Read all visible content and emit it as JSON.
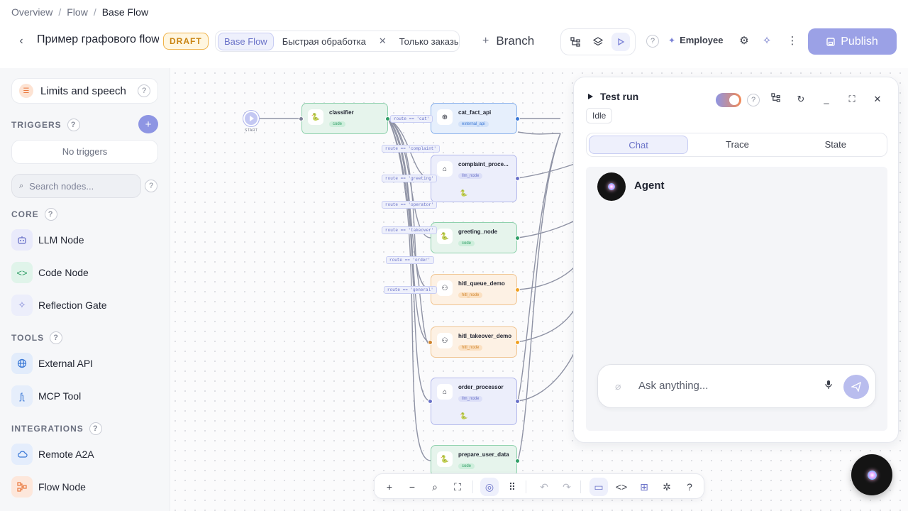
{
  "breadcrumb": {
    "items": [
      "Overview",
      "Flow"
    ],
    "current": "Base Flow"
  },
  "header": {
    "title": "Пример графового flow",
    "draft_badge": "DRAFT",
    "tabs": [
      {
        "label": "Base Flow",
        "active": true
      },
      {
        "label": "Быстрая обработка",
        "active": false,
        "closable": true
      },
      {
        "label": "Только заказы",
        "active": false
      }
    ],
    "branch_label": "Branch",
    "employee_label": "Employee",
    "publish_label": "Publish",
    "accent_color": "#9ba1e6"
  },
  "sidebar": {
    "limits_label": "Limits and speech",
    "triggers_label": "TRIGGERS",
    "no_triggers": "No triggers",
    "search_placeholder": "Search nodes...",
    "core_label": "CORE",
    "core_items": [
      {
        "label": "LLM Node",
        "icon": "robot-icon"
      },
      {
        "label": "Code Node",
        "icon": "code-icon"
      },
      {
        "label": "Reflection Gate",
        "icon": "sparkle-icon"
      }
    ],
    "tools_label": "TOOLS",
    "tools_items": [
      {
        "label": "External API",
        "icon": "globe-icon"
      },
      {
        "label": "MCP Tool",
        "icon": "mcp-icon"
      }
    ],
    "integrations_label": "INTEGRATIONS",
    "integrations_items": [
      {
        "label": "Remote A2A",
        "icon": "cloud-icon"
      },
      {
        "label": "Flow Node",
        "icon": "flow-icon"
      }
    ]
  },
  "canvas": {
    "start_label": "START",
    "nodes": [
      {
        "title": "classifier",
        "tag": "code"
      },
      {
        "title": "cat_fact_api",
        "tag": "external_api"
      },
      {
        "title": "complaint_proce...",
        "tag": "llm_node"
      },
      {
        "title": "greeting_node",
        "tag": "code"
      },
      {
        "title": "hitl_queue_demo",
        "tag": "hitl_node"
      },
      {
        "title": "hitl_takeover_demo",
        "tag": "hitl_node"
      },
      {
        "title": "order_processor",
        "tag": "llm_node"
      },
      {
        "title": "prepare_user_data",
        "tag": "code"
      }
    ],
    "routes": [
      "route == 'cat'",
      "route == 'complaint'",
      "route == 'greeting'",
      "route == 'operator'",
      "route == 'takeover'",
      "route == 'order'",
      "route == 'general'"
    ]
  },
  "test_run": {
    "title": "Test run",
    "status": "Idle",
    "tabs": [
      {
        "label": "Chat",
        "active": true
      },
      {
        "label": "Trace",
        "active": false
      },
      {
        "label": "State",
        "active": false
      }
    ],
    "agent_name": "Agent",
    "input_placeholder": "Ask anything..."
  }
}
